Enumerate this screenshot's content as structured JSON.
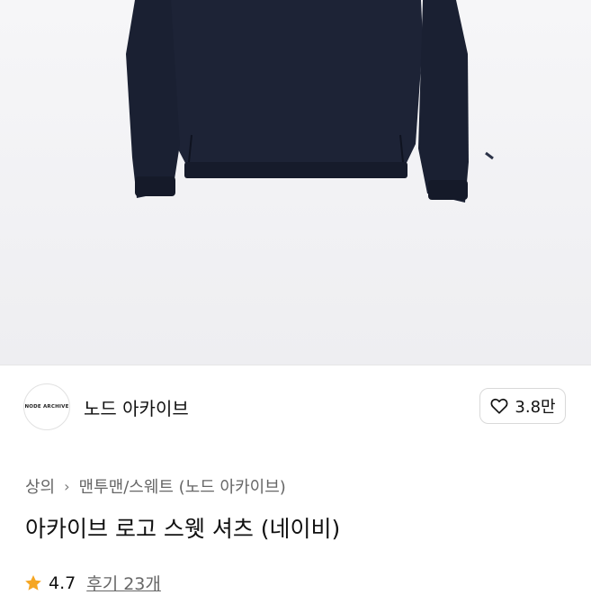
{
  "brand": {
    "logo_text": "NODE ARCHIVE",
    "name": "노드 아카이브",
    "like_count": "3.8만"
  },
  "breadcrumb": {
    "root": "상의",
    "category": "맨투맨/스웨트 (노드 아카이브)"
  },
  "product": {
    "title": "아카이브 로고 스웻 셔츠 (네이비)",
    "rating": "4.7",
    "reviews_label": "후기 23개"
  },
  "icons": {
    "like": "heart-icon",
    "separator": "chevron-right-icon",
    "rating": "star-icon"
  },
  "colors": {
    "garment": "#1e2437",
    "star": "#f5a623"
  }
}
